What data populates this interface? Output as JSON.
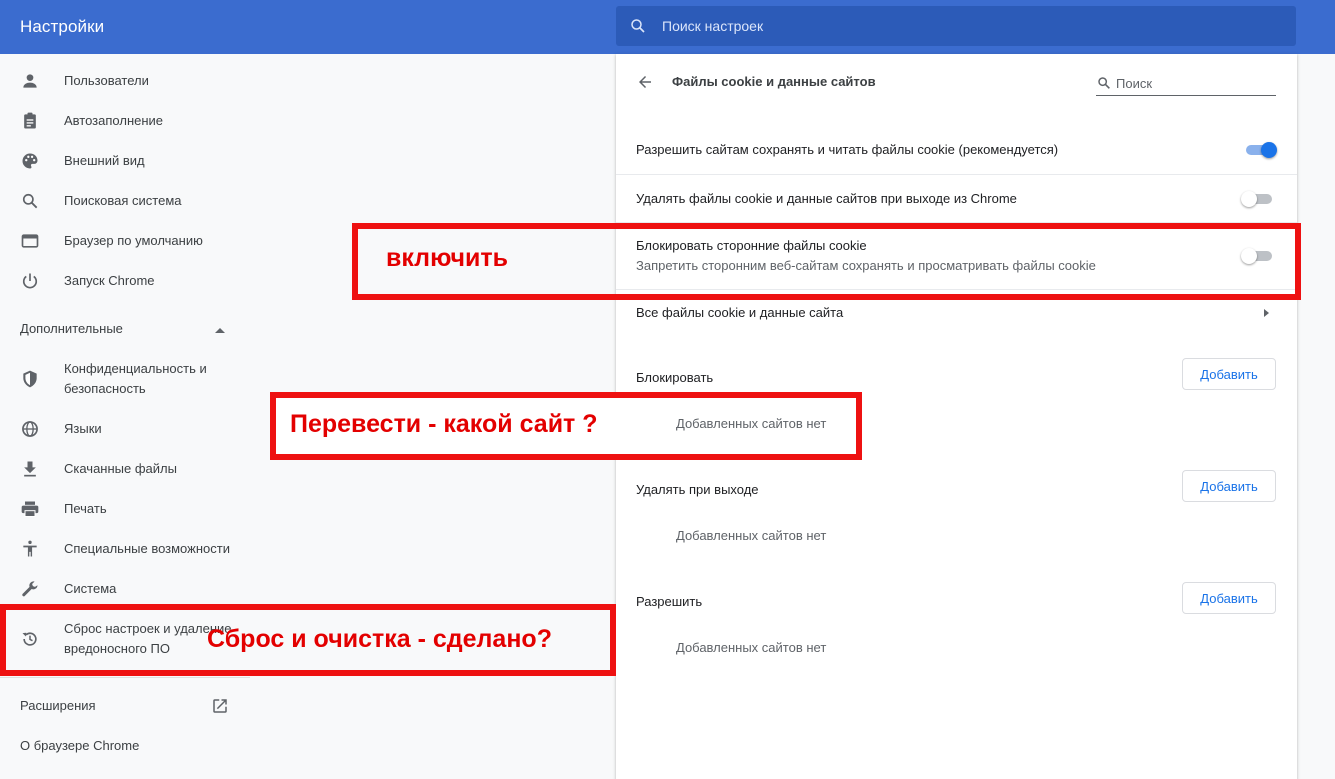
{
  "header": {
    "title": "Настройки",
    "search_placeholder": "Поиск настроек"
  },
  "sidebar": {
    "items": [
      {
        "label": "Пользователи",
        "icon": "person-icon"
      },
      {
        "label": "Автозаполнение",
        "icon": "clipboard-icon"
      },
      {
        "label": "Внешний вид",
        "icon": "palette-icon"
      },
      {
        "label": "Поисковая система",
        "icon": "search-icon"
      },
      {
        "label": "Браузер по умолчанию",
        "icon": "browser-window-icon"
      },
      {
        "label": "Запуск Chrome",
        "icon": "power-icon"
      }
    ],
    "advanced_label": "Дополнительные",
    "advanced_items": [
      {
        "label": "Конфиденциальность и",
        "label2": "безопасность",
        "icon": "shield-icon"
      },
      {
        "label": "Языки",
        "icon": "globe-icon"
      },
      {
        "label": "Скачанные файлы",
        "icon": "download-icon"
      },
      {
        "label": "Печать",
        "icon": "printer-icon"
      },
      {
        "label": "Специальные возможности",
        "icon": "accessibility-icon"
      },
      {
        "label": "Система",
        "icon": "wrench-icon"
      },
      {
        "label": "Сброс настроек и удаление",
        "label2": "вредоносного ПО",
        "icon": "restore-icon"
      }
    ],
    "extensions_label": "Расширения",
    "about_label": "О браузере Chrome"
  },
  "main": {
    "title": "Файлы cookie и данные сайтов",
    "search_placeholder": "Поиск",
    "rows": [
      {
        "label": "Разрешить сайтам сохранять и читать файлы cookie (рекомендуется)",
        "toggle": "on"
      },
      {
        "label": "Удалять файлы cookie и данные сайтов при выходе из Chrome",
        "toggle": "off"
      },
      {
        "label": "Блокировать сторонние файлы cookie",
        "sublabel": "Запретить сторонним веб-сайтам сохранять и просматривать файлы cookie",
        "toggle": "off"
      }
    ],
    "all_cookies_label": "Все файлы cookie и данные сайта",
    "sections": [
      {
        "title": "Блокировать",
        "button": "Добавить",
        "empty": "Добавленных сайтов нет"
      },
      {
        "title": "Удалять при выходе",
        "button": "Добавить",
        "empty": "Добавленных сайтов нет"
      },
      {
        "title": "Разрешить",
        "button": "Добавить",
        "empty": "Добавленных сайтов нет"
      }
    ]
  },
  "annotations": {
    "enable": "включить",
    "translate": "Перевести - какой сайт ?",
    "reset": "Сброс и очистка - сделано?",
    "color": "#ee1111"
  },
  "colors": {
    "header": "#3b6ccf",
    "accent": "#1a73e8"
  }
}
